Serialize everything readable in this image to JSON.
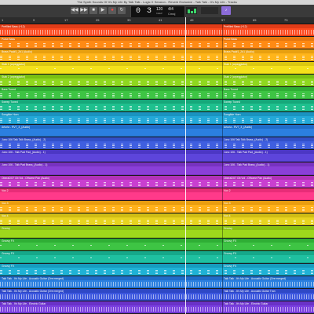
{
  "window": {
    "title": "The Synth Sounds Of It's My Life By Talk Talk - Logic X Session - Reverb Exclusive - Talk Talk - It's My Life - Tracks"
  },
  "toolbar": {
    "buttons": [
      {
        "icon": "rewind-icon",
        "glyph": "◀◀"
      },
      {
        "icon": "fast-forward-icon",
        "glyph": "▶▶"
      },
      {
        "icon": "stop-icon",
        "glyph": "■"
      },
      {
        "icon": "play-icon",
        "glyph": "▶"
      },
      {
        "icon": "record-icon",
        "glyph": "●"
      },
      {
        "icon": "cycle-icon",
        "glyph": "↻"
      }
    ],
    "lcd": {
      "position": "0  3",
      "tempo": "120",
      "tempo_label": "KEEP",
      "signature": "4/4",
      "key": "Cmaj"
    },
    "accent_button": "♪",
    "accent_color": "#8c6cd9"
  },
  "ruler": {
    "marks": [
      "1",
      "9",
      "17",
      "25",
      "33",
      "41",
      "49",
      "57",
      "65",
      "73"
    ]
  },
  "tracks": [
    {
      "name": "Prefilled Bass (+12)",
      "name2": "Prefilled Bass (+12)",
      "color": "#ff4a1f",
      "header": "#e03c18",
      "type": "dense"
    },
    {
      "name": "Pulse Bass",
      "name2": "Pulse Bass",
      "color": "#ff8a14",
      "header": "#e87810",
      "type": "notes"
    },
    {
      "name": "Brass Pad#1_2#1 (Audio)",
      "name2": "Brass Pad#1_2#1 (Audio)",
      "color": "#ffb51a",
      "header": "#e8a010",
      "type": "notes"
    },
    {
      "name": "Stab 1 (arpeggiator)",
      "name2": "Stab 1 (arpeggiator)",
      "color": "#f5e11a",
      "header": "#dcc810",
      "type": "sparse"
    },
    {
      "name": "Stab 2 (arpeggiator)",
      "name2": "Stab 2 (arpeggiator)",
      "color": "#8fd81f",
      "header": "#79c012",
      "type": "notes"
    },
    {
      "name": "Bass Tuned",
      "name2": "Bass Tuned",
      "color": "#3ec444",
      "header": "#2fae35",
      "type": "notes"
    },
    {
      "name": "Sweep Tuned",
      "name2": "Sweep Tuned",
      "color": "#1fc08e",
      "header": "#16a87a",
      "type": "notes"
    },
    {
      "name": "Songlide Horn",
      "name2": "Songlide Horn",
      "color": "#23a9d8",
      "header": "#1a93c0",
      "type": "notes"
    },
    {
      "name": "Arturia - RV7_3_(Audio)",
      "name2": "Arturia - RV7_3_(Audio)",
      "color": "#2b7fe0",
      "header": "#206cc8",
      "type": "empty"
    },
    {
      "name": "Juno 106 Talk Talk Brass_(Audio) - 2)",
      "name2": "Juno 106 Talk Talk Brass_(Audio) - 2)",
      "color": "#3f5fe0",
      "header": "#3250c8",
      "type": "notes"
    },
    {
      "name": "Juno 106 - Talk Pad Pad_(Audio) - 1)",
      "name2": "Juno 106 - Talk Pad Pad_(Audio) - 1)",
      "color": "#5d45db",
      "header": "#4c37c4",
      "type": "empty"
    },
    {
      "name": "Juno 106 - Talk Pad Brass_(Audio) - 1)",
      "name2": "Juno 106 - Talk Pad Brass_(Audio) - 1)",
      "color": "#8a3fd8",
      "header": "#7732c0",
      "type": "empty"
    },
    {
      "name": "OberaDX7 Ob Vol - Ofhome Pan (Audio)",
      "name2": "OberaDX7 Ob Vol - Ofhome Pan (Audio)",
      "color": "#c93fd0",
      "header": "#b132b8",
      "type": "notes"
    },
    {
      "name": "Vox 2",
      "name2": "Vox 2",
      "color": "#ff3a8a",
      "header": "#e82c78",
      "type": "empty"
    },
    {
      "name": "Vox 3",
      "name2": "Vox 3",
      "color": "#ffb21a",
      "header": "#e89e10",
      "type": "notes"
    },
    {
      "name": "Vox 4",
      "name2": "Vox 4",
      "color": "#e8d420",
      "header": "#d0bd14",
      "type": "notes"
    },
    {
      "name": "Groovy",
      "name2": "Groovy",
      "color": "#9ed81c",
      "header": "#88c012",
      "type": "empty"
    },
    {
      "name": "Groovy FX",
      "name2": "Groovy FX",
      "color": "#3ec444",
      "header": "#2fae35",
      "type": "sparse"
    },
    {
      "name": "Groovy FX",
      "name2": "Groovy FX",
      "color": "#1fc0a0",
      "header": "#16a88a",
      "type": "sparse"
    },
    {
      "name": "Groovy FX",
      "name2": "Groovy FX",
      "color": "#1fb2d6",
      "header": "#169cbe",
      "type": "notes"
    },
    {
      "name": "Talk Talk - It's My Life - Acoustic Guitar (Ore merged)",
      "name2": "Talk Talk - It's My Life - Acoustic Guitar (Ore merged)",
      "color": "#2a7fe0",
      "header": "#206cc8",
      "type": "dense"
    },
    {
      "name": "Talk Talk - It's My Life - Acoustic Guitar (Ore merged)",
      "name2": "Talk Talk - It's My Life - Acoustic Guitar Tran",
      "color": "#3b56de",
      "header": "#2e48c6",
      "type": "dense"
    },
    {
      "name": "Talk Talk - It's My Life - Electric Guitar",
      "name2": "Talk Talk - It's My Life - Electric Guitar",
      "color": "#7a3fe0",
      "header": "#6a32c8",
      "type": "dense"
    }
  ]
}
